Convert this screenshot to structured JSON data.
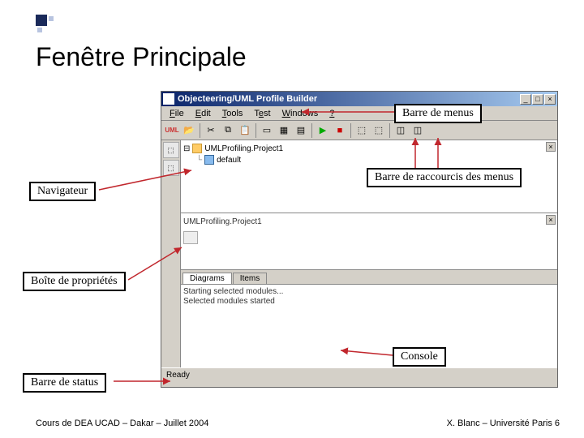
{
  "slide": {
    "title": "Fenêtre Principale",
    "footer_left": "Cours de DEA UCAD – Dakar – Juillet 2004",
    "footer_right": "X. Blanc – Université Paris 6"
  },
  "app": {
    "title": "Objecteering/UML Profile Builder",
    "menus": [
      "File",
      "Edit",
      "Tools",
      "Test",
      "Windows",
      "?"
    ],
    "tree": {
      "root": "UMLProfiling.Project1",
      "child": "default"
    },
    "props_title": "UMLProfiling.Project1",
    "tabs": [
      "Diagrams",
      "Items"
    ],
    "console_lines": [
      "Starting selected modules...",
      "Selected modules started"
    ],
    "status": "Ready"
  },
  "annotations": {
    "menus": "Barre de menus",
    "shortcuts": "Barre de raccourcis des menus",
    "navigator": "Navigateur",
    "properties": "Boîte de propriétés",
    "console": "Console",
    "status": "Barre de status"
  }
}
